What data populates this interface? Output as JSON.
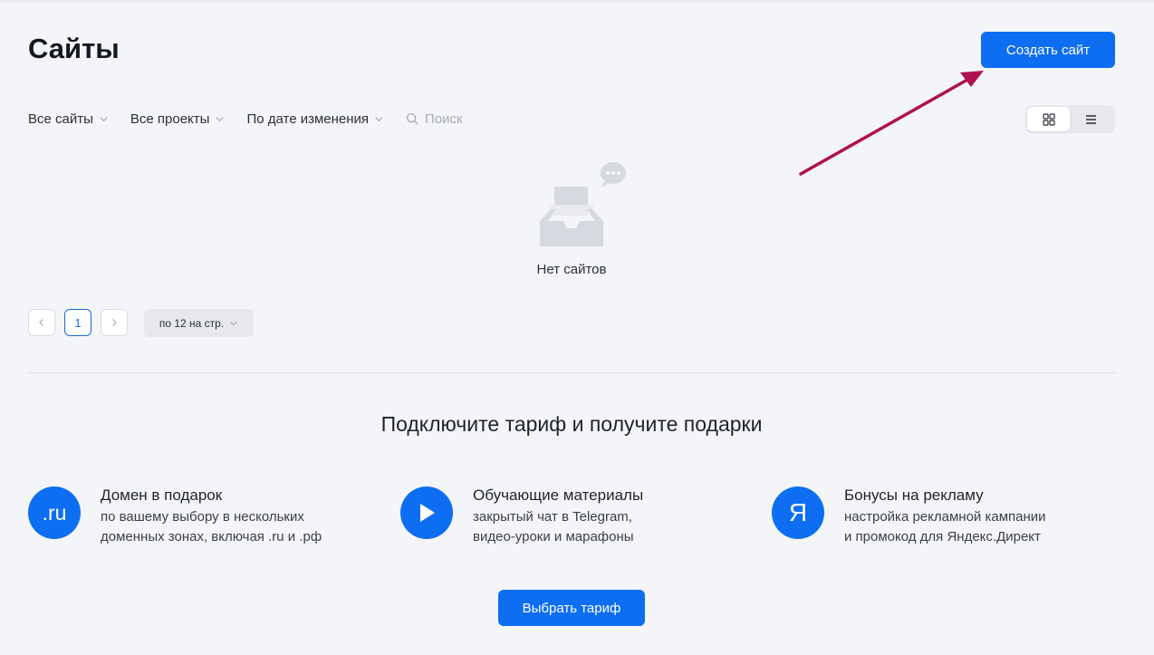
{
  "page": {
    "title": "Сайты"
  },
  "header": {
    "create_label": "Создать сайт"
  },
  "filters": {
    "sites": "Все сайты",
    "projects": "Все проекты",
    "sort": "По дате изменения",
    "search_placeholder": "Поиск"
  },
  "view_toggle": {
    "active": "grid",
    "options": [
      "grid-icon",
      "list-icon"
    ]
  },
  "empty": {
    "text": "Нет сайтов"
  },
  "pagination": {
    "prev_icon": "chevron-left-icon",
    "current_page": "1",
    "next_icon": "chevron-right-icon",
    "per_page": "по 12 на стр."
  },
  "promo": {
    "title": "Подключите тариф и получите подарки",
    "features": [
      {
        "icon_text": ".ru",
        "title": "Домен в подарок",
        "desc1": "по вашему выбору в нескольких",
        "desc2": "доменных зонах, включая .ru и .рф"
      },
      {
        "icon": "play-icon",
        "title": "Обучающие материалы",
        "desc1": "закрытый чат в Telegram,",
        "desc2": "видео-уроки и марафоны"
      },
      {
        "icon_text": "Я",
        "title": "Бонусы на рекламу",
        "desc1": "настройка рекламной кампании",
        "desc2": "и промокод для Яндекс.Директ"
      }
    ],
    "cta_label": "Выбрать тариф"
  },
  "colors": {
    "accent": "#0d6ef1",
    "annotation_arrow": "#b0104f",
    "background": "#f4f5f9"
  }
}
